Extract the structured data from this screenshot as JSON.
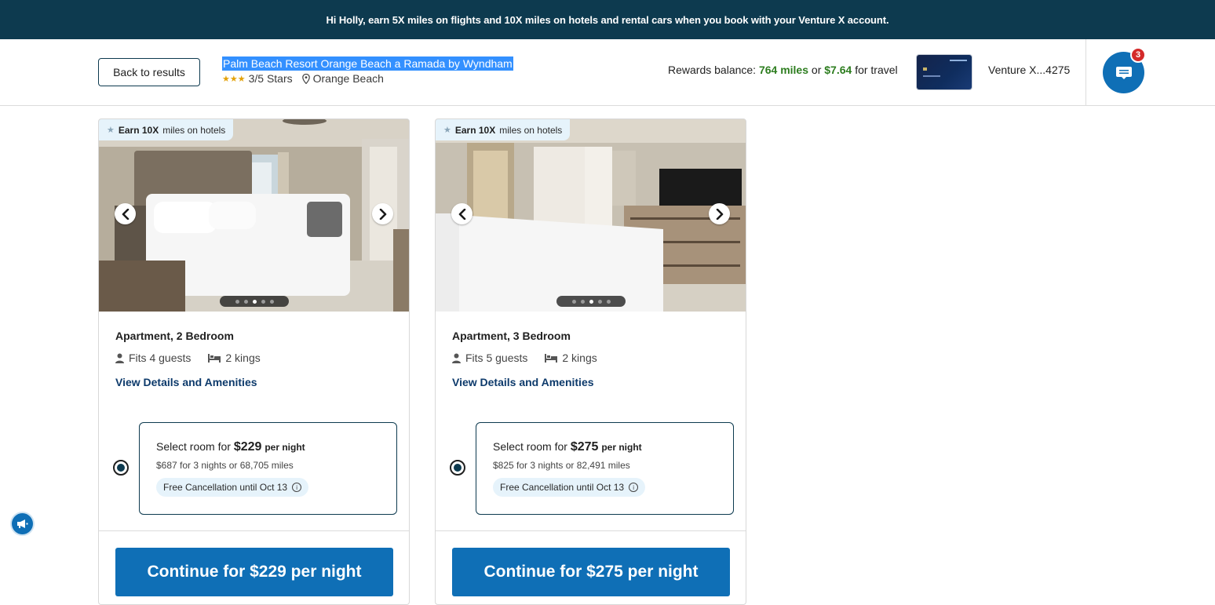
{
  "banner": {
    "text": "Hi Holly, earn 5X miles on flights and 10X miles on hotels and rental cars when you book with your Venture X account."
  },
  "header": {
    "back_label": "Back to results",
    "hotel_name": "Palm Beach Resort Orange Beach a Ramada by Wyndham",
    "stars_text": "3/5 Stars",
    "star_count": 3,
    "location": "Orange Beach",
    "rewards_prefix": "Rewards balance:",
    "rewards_miles": "764 miles",
    "rewards_or": "or",
    "rewards_cash": "$7.64",
    "rewards_suffix": "for travel",
    "card_label": "Venture X...4275",
    "chat_badge_count": "3"
  },
  "rooms": [
    {
      "earn_bold": "Earn 10X",
      "earn_rest": "miles on hotels",
      "title": "Apartment, 2 Bedroom",
      "guests": "Fits 4 guests",
      "beds": "2 kings",
      "details_link": "View Details and Amenities",
      "select_prefix": "Select room for",
      "price": "$229",
      "per_night": "per night",
      "total_line": "$687 for 3 nights or 68,705 miles",
      "cancellation": "Free Cancellation until Oct 13",
      "continue_label": "Continue for $229 per night",
      "photo_index": 3,
      "photo_count": 5
    },
    {
      "earn_bold": "Earn 10X",
      "earn_rest": "miles on hotels",
      "title": "Apartment, 3 Bedroom",
      "guests": "Fits 5 guests",
      "beds": "2 kings",
      "details_link": "View Details and Amenities",
      "select_prefix": "Select room for",
      "price": "$275",
      "per_night": "per night",
      "total_line": "$825 for 3 nights or 82,491 miles",
      "cancellation": "Free Cancellation until Oct 13",
      "continue_label": "Continue for $275 per night",
      "photo_index": 3,
      "photo_count": 5
    }
  ],
  "colors": {
    "banner_bg": "#0d3a4f",
    "primary_button": "#0f6fb6",
    "rewards_green": "#2d7d1f",
    "tag_bg": "#e6f3fb"
  }
}
